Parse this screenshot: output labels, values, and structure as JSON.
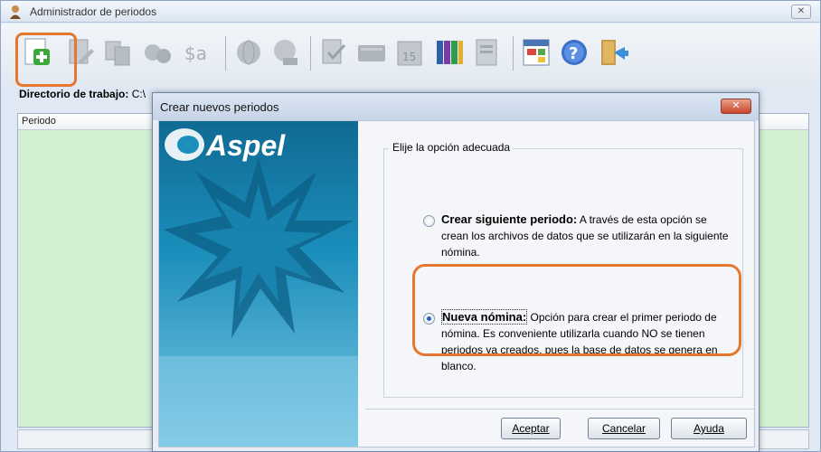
{
  "main_window": {
    "title": "Administrador de periodos",
    "close_label": "✕",
    "workdir_label": "Directorio de trabajo:",
    "workdir_value": "C:\\",
    "list_header": "Periodo"
  },
  "toolbar": {
    "buttons": [
      "new-period-icon",
      "edit-doc-icon",
      "copy-icon",
      "calc-icon",
      "money-icon",
      "globe-icon",
      "globe2-icon",
      "doc-check-icon",
      "keyboard-icon",
      "calendar-icon",
      "books-icon",
      "report-icon",
      "grid-icon",
      "help-icon",
      "exit-icon"
    ]
  },
  "dialog": {
    "title": "Crear nuevos periodos",
    "close_label": "✕",
    "group_label": "Elije la opción adecuada",
    "option1": {
      "title": "Crear siguiente periodo:",
      "text": " A través de esta opción se crean los archivos de datos que se utilizarán en la siguiente nómina.",
      "checked": false
    },
    "option2": {
      "title": "Nueva nómina:",
      "text": " Opción para crear el primer periodo de nómina. Es conveniente utilizarla cuando NO se tienen periodos ya creados, pues la base de datos se genera en blanco.",
      "checked": true
    },
    "brand": "Aspel",
    "buttons": {
      "accept": "Aceptar",
      "cancel": "Cancelar",
      "help": "Ayuda"
    }
  },
  "colors": {
    "highlight": "#e5782e",
    "list_bg": "#d3f0d3",
    "brand_blue": "#1b8ebc"
  }
}
